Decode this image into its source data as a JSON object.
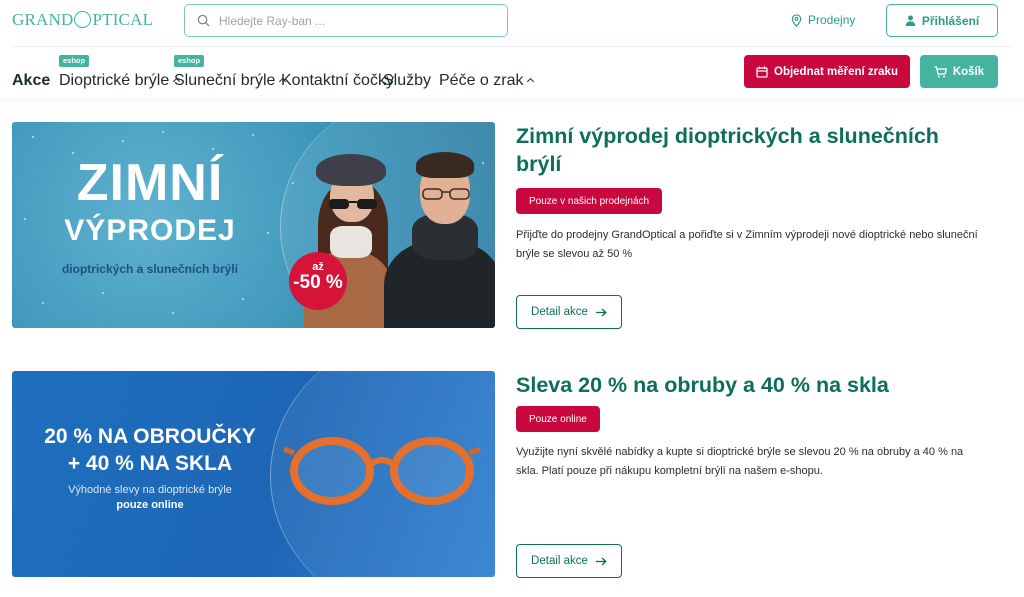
{
  "header": {
    "logo": {
      "text_left": "GRAND",
      "text_right": "PTICAL"
    },
    "search": {
      "placeholder": "Hledejte Ray-ban ...",
      "value": ""
    },
    "stores_label": "Prodejny",
    "login_label": "Přihlášení"
  },
  "nav": {
    "items": [
      {
        "label": "Akce",
        "active": true,
        "has_chevron": false,
        "badge": ""
      },
      {
        "label": "Dioptrické brýle",
        "active": false,
        "has_chevron": true,
        "badge": "eshop"
      },
      {
        "label": "Sluneční brýle",
        "active": false,
        "has_chevron": true,
        "badge": "eshop"
      },
      {
        "label": "Kontaktní čočky",
        "active": false,
        "has_chevron": false,
        "badge": ""
      },
      {
        "label": "Služby",
        "active": false,
        "has_chevron": false,
        "badge": ""
      },
      {
        "label": "Péče o zrak",
        "active": false,
        "has_chevron": true,
        "badge": ""
      }
    ],
    "order_button": "Objednat měření zraku",
    "cart_button": "Košík"
  },
  "promos": [
    {
      "banner": {
        "line1": "ZIMNÍ",
        "line2": "VÝPRODEJ",
        "subtitle": "dioptrických a slunečních brýlí",
        "badge_top": "až",
        "badge_value": "-50 %"
      },
      "title": "Zimní výprodej dioptrických a slunečních brýlí",
      "tag": "Pouze v našich prodejnách",
      "description": "Přijďte do prodejny GrandOptical a pořiďte si v Zimním výprodeji nové dioptrické nebo sluneční brýle se slevou až 50 %",
      "button": "Detail akce"
    },
    {
      "banner": {
        "line1": "20 % NA OBROUČKY",
        "line2": "+ 40 % NA SKLA",
        "subtitle": "Výhodné slevy na dioptrické brýle",
        "subtitle_bold": "pouze online"
      },
      "title": "Sleva 20 % na obruby a 40 % na skla",
      "tag": "Pouze online",
      "description": "Využijte nyní skvělé nabídky a kupte si dioptrické brýle se slevou 20 % na obruby a 40 % na skla. Platí pouze při nákupu kompletní brýlí na našem e-shopu.",
      "button": "Detail akce"
    }
  ],
  "colors": {
    "brand_green": "#45b49f",
    "dark_green": "#0d6e5a",
    "accent_red": "#c8083e"
  }
}
